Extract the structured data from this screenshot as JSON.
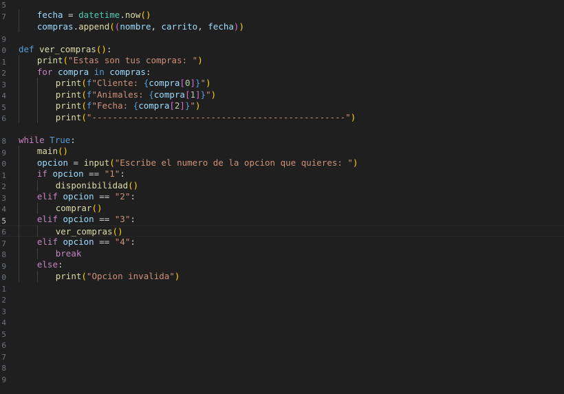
{
  "editor": {
    "active_line": "5",
    "line_numbers": [
      "5",
      "7",
      "",
      "9",
      "0",
      "1",
      "2",
      "3",
      "4",
      "5",
      "6",
      "",
      "8",
      "9",
      "0",
      "1",
      "2",
      "3",
      "4",
      "5",
      "6",
      "7",
      "8",
      "9",
      "0",
      "1",
      "2",
      "3",
      "4",
      "5",
      "6",
      "7",
      "8",
      "9"
    ],
    "lines": [
      {
        "indent": 4,
        "tokens": [
          [
            "var",
            "fecha"
          ],
          [
            "op",
            " = "
          ],
          [
            "cls",
            "datetime"
          ],
          [
            "op",
            "."
          ],
          [
            "fn",
            "now"
          ],
          [
            "p1",
            "()"
          ]
        ]
      },
      {
        "indent": 4,
        "tokens": [
          [
            "var",
            "compras"
          ],
          [
            "op",
            "."
          ],
          [
            "fn",
            "append"
          ],
          [
            "p1",
            "("
          ],
          [
            "p2",
            "("
          ],
          [
            "var",
            "nombre"
          ],
          [
            "op",
            ", "
          ],
          [
            "var",
            "carrito"
          ],
          [
            "op",
            ", "
          ],
          [
            "var",
            "fecha"
          ],
          [
            "p2",
            ")"
          ],
          [
            "p1",
            ")"
          ]
        ]
      },
      {
        "indent": 0,
        "tokens": []
      },
      {
        "indent": 0,
        "tokens": [
          [
            "kw",
            "def"
          ],
          [
            "op",
            " "
          ],
          [
            "fn",
            "ver_compras"
          ],
          [
            "p1",
            "()"
          ],
          [
            "op",
            ":"
          ]
        ]
      },
      {
        "indent": 4,
        "tokens": [
          [
            "fn",
            "print"
          ],
          [
            "p1",
            "("
          ],
          [
            "str",
            "\"Estas son tus compras: \""
          ],
          [
            "p1",
            ")"
          ]
        ]
      },
      {
        "indent": 4,
        "tokens": [
          [
            "ctl",
            "for"
          ],
          [
            "op",
            " "
          ],
          [
            "var",
            "compra"
          ],
          [
            "op",
            " "
          ],
          [
            "kw",
            "in"
          ],
          [
            "op",
            " "
          ],
          [
            "var",
            "compras"
          ],
          [
            "op",
            ":"
          ]
        ]
      },
      {
        "indent": 8,
        "tokens": [
          [
            "fn",
            "print"
          ],
          [
            "p1",
            "("
          ],
          [
            "kw",
            "f"
          ],
          [
            "str",
            "\"Cliente: "
          ],
          [
            "kw",
            "{"
          ],
          [
            "var",
            "compra"
          ],
          [
            "p2",
            "["
          ],
          [
            "num",
            "0"
          ],
          [
            "p2",
            "]"
          ],
          [
            "kw",
            "}"
          ],
          [
            "str",
            "\""
          ],
          [
            "p1",
            ")"
          ]
        ]
      },
      {
        "indent": 8,
        "tokens": [
          [
            "fn",
            "print"
          ],
          [
            "p1",
            "("
          ],
          [
            "kw",
            "f"
          ],
          [
            "str",
            "\"Animales: "
          ],
          [
            "kw",
            "{"
          ],
          [
            "var",
            "compra"
          ],
          [
            "p2",
            "["
          ],
          [
            "num",
            "1"
          ],
          [
            "p2",
            "]"
          ],
          [
            "kw",
            "}"
          ],
          [
            "str",
            "\""
          ],
          [
            "p1",
            ")"
          ]
        ]
      },
      {
        "indent": 8,
        "tokens": [
          [
            "fn",
            "print"
          ],
          [
            "p1",
            "("
          ],
          [
            "kw",
            "f"
          ],
          [
            "str",
            "\"Fecha: "
          ],
          [
            "kw",
            "{"
          ],
          [
            "var",
            "compra"
          ],
          [
            "p2",
            "["
          ],
          [
            "num",
            "2"
          ],
          [
            "p2",
            "]"
          ],
          [
            "kw",
            "}"
          ],
          [
            "str",
            "\""
          ],
          [
            "p1",
            ")"
          ]
        ]
      },
      {
        "indent": 8,
        "tokens": [
          [
            "fn",
            "print"
          ],
          [
            "p1",
            "("
          ],
          [
            "str",
            "\"-------------------------------------------------\""
          ],
          [
            "p1",
            ")"
          ]
        ]
      },
      {
        "indent": 0,
        "tokens": []
      },
      {
        "indent": 0,
        "tokens": [
          [
            "ctl",
            "while"
          ],
          [
            "op",
            " "
          ],
          [
            "kw",
            "True"
          ],
          [
            "op",
            ":"
          ]
        ]
      },
      {
        "indent": 4,
        "tokens": [
          [
            "fn",
            "main"
          ],
          [
            "p1",
            "()"
          ]
        ]
      },
      {
        "indent": 4,
        "tokens": [
          [
            "var",
            "opcion"
          ],
          [
            "op",
            " = "
          ],
          [
            "fn",
            "input"
          ],
          [
            "p1",
            "("
          ],
          [
            "str",
            "\"Escribe el numero de la opcion que quieres: \""
          ],
          [
            "p1",
            ")"
          ]
        ]
      },
      {
        "indent": 4,
        "tokens": [
          [
            "ctl",
            "if"
          ],
          [
            "op",
            " "
          ],
          [
            "var",
            "opcion"
          ],
          [
            "op",
            " == "
          ],
          [
            "str",
            "\"1\""
          ],
          [
            "op",
            ":"
          ]
        ]
      },
      {
        "indent": 8,
        "tokens": [
          [
            "fn",
            "disponibilidad"
          ],
          [
            "p1",
            "()"
          ]
        ]
      },
      {
        "indent": 4,
        "tokens": [
          [
            "ctl",
            "elif"
          ],
          [
            "op",
            " "
          ],
          [
            "var",
            "opcion"
          ],
          [
            "op",
            " == "
          ],
          [
            "str",
            "\"2\""
          ],
          [
            "op",
            ":"
          ]
        ]
      },
      {
        "indent": 8,
        "tokens": [
          [
            "fn",
            "comprar"
          ],
          [
            "p1",
            "()"
          ]
        ]
      },
      {
        "indent": 4,
        "tokens": [
          [
            "ctl",
            "elif"
          ],
          [
            "op",
            " "
          ],
          [
            "var",
            "opcion"
          ],
          [
            "op",
            " == "
          ],
          [
            "str",
            "\"3\""
          ],
          [
            "op",
            ":"
          ]
        ]
      },
      {
        "indent": 8,
        "tokens": [
          [
            "fn",
            "ver_compras"
          ],
          [
            "p1",
            "()"
          ]
        ]
      },
      {
        "indent": 4,
        "tokens": [
          [
            "ctl",
            "elif"
          ],
          [
            "op",
            " "
          ],
          [
            "var",
            "opcion"
          ],
          [
            "op",
            " == "
          ],
          [
            "str",
            "\"4\""
          ],
          [
            "op",
            ":"
          ]
        ]
      },
      {
        "indent": 8,
        "tokens": [
          [
            "ctl",
            "break"
          ]
        ]
      },
      {
        "indent": 4,
        "tokens": [
          [
            "ctl",
            "else"
          ],
          [
            "op",
            ":"
          ]
        ]
      },
      {
        "indent": 8,
        "tokens": [
          [
            "fn",
            "print"
          ],
          [
            "p1",
            "("
          ],
          [
            "str",
            "\"Opcion invalida\""
          ],
          [
            "p1",
            ")"
          ]
        ]
      }
    ]
  }
}
